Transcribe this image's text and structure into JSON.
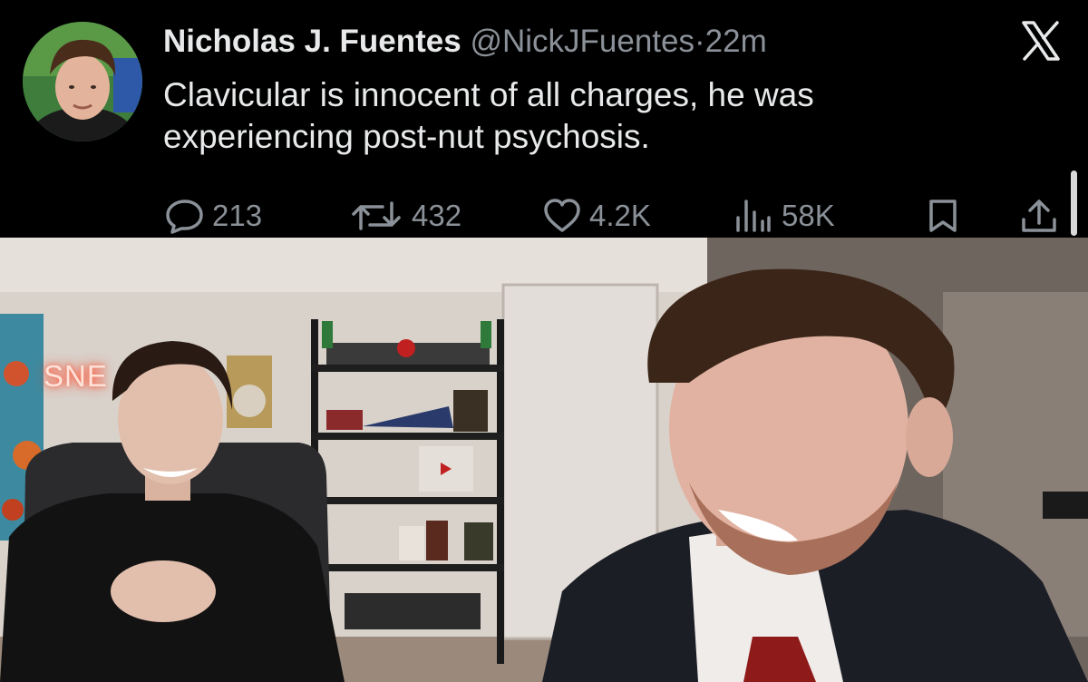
{
  "tweet": {
    "author_name": "Nicholas J. Fuentes",
    "handle": "@NickJFuentes",
    "separator": "·",
    "time": "22m",
    "text_lines": [
      "Clavicular is innocent of all charges, he was",
      "experiencing post-nut psychosis."
    ],
    "platform_logo": "x-logo-icon",
    "actions": {
      "replies": "213",
      "reposts": "432",
      "likes": "4.2K",
      "views": "58K"
    }
  },
  "video_frame": {
    "neon_sign_text": "SNE"
  },
  "colors": {
    "background": "#000000",
    "primary_text": "#e7e9ea",
    "secondary_text": "#8b9198"
  }
}
